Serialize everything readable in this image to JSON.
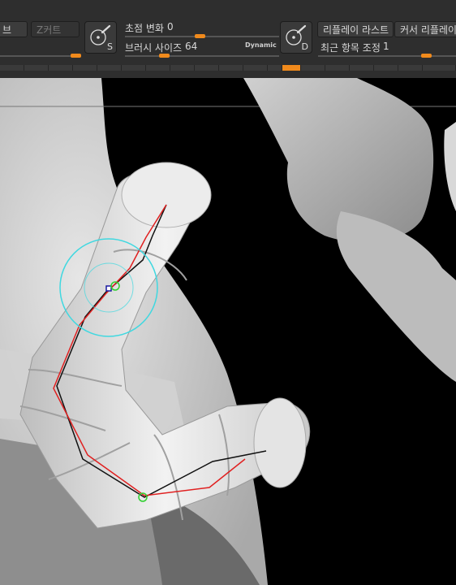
{
  "toolbar": {
    "btn_left_partial": "브",
    "btn_z_cut": "Z커트",
    "s_key": "S",
    "d_key": "D",
    "focal_shift_label": "초점 변화",
    "focal_shift_value": "0",
    "brush_size_label": "브러시 사이즈",
    "brush_size_value": "64",
    "dynamic_label": "Dynamic",
    "replay_last": "리플레이 라스트",
    "cursor_replay": "커서 리플레이",
    "recent_adjust_label": "최근 항목 조정",
    "recent_adjust_value": "1"
  },
  "colors": {
    "accent": "#f08a1c",
    "panel": "#2e2e2e",
    "curve_red": "#e02020",
    "curve_black": "#111111",
    "brush_ring": "#40d8e0",
    "point_green": "#30d030"
  }
}
